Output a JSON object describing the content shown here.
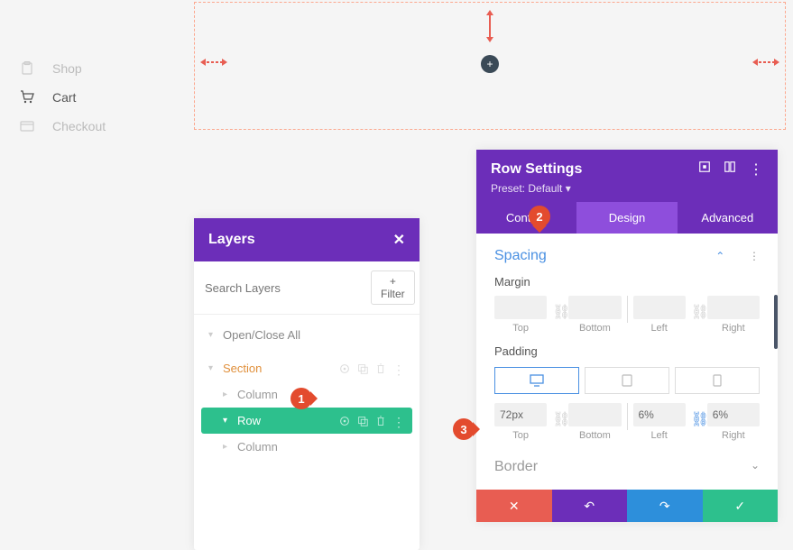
{
  "sidebar": {
    "items": [
      {
        "label": "Shop",
        "icon": "shop"
      },
      {
        "label": "Cart",
        "icon": "cart"
      },
      {
        "label": "Checkout",
        "icon": "card"
      }
    ],
    "active_index": 1
  },
  "layers": {
    "title": "Layers",
    "search_placeholder": "Search Layers",
    "filter_label": "Filter",
    "open_close_all": "Open/Close All",
    "items": [
      {
        "label": "Section",
        "type": "section"
      },
      {
        "label": "Column",
        "type": "column"
      },
      {
        "label": "Row",
        "type": "row",
        "selected": true
      },
      {
        "label": "Column",
        "type": "column"
      }
    ]
  },
  "settings": {
    "title": "Row Settings",
    "preset": "Preset: Default",
    "tabs": [
      "Content",
      "Design",
      "Advanced"
    ],
    "active_tab": 1,
    "spacing": {
      "section_label": "Spacing",
      "margin_label": "Margin",
      "padding_label": "Padding",
      "sublabels": [
        "Top",
        "Bottom",
        "Left",
        "Right"
      ],
      "margin_values": [
        "",
        "",
        "",
        ""
      ],
      "padding_values": [
        "72px",
        "",
        "6%",
        "6%"
      ],
      "responsive_active": 0
    },
    "border_label": "Border"
  },
  "callouts": {
    "c1": "1",
    "c2": "2",
    "c3": "3"
  },
  "colors": {
    "purple": "#6c2eb9",
    "green": "#2dc08d",
    "orange": "#e08f3a",
    "red": "#e85d52",
    "blue": "#2d8fdb"
  }
}
